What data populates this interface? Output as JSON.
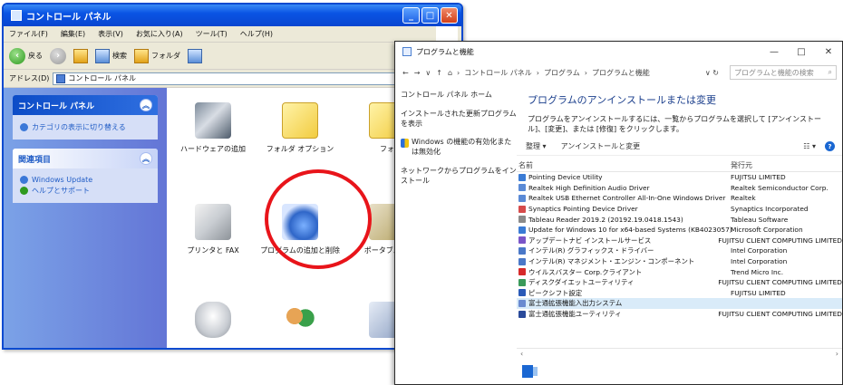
{
  "xp": {
    "title": "コントロール パネル",
    "controls": [
      "_",
      "□",
      "✕"
    ],
    "menu": [
      "ファイル(F)",
      "編集(E)",
      "表示(V)",
      "お気に入り(A)",
      "ツール(T)",
      "ヘルプ(H)"
    ],
    "toolbar": {
      "back": "戻る",
      "search": "検索",
      "folders": "フォルダ"
    },
    "address": {
      "label": "アドレス(D)",
      "value": "コントロール パネル"
    },
    "left": {
      "panel1": {
        "title": "コントロール パネル",
        "link": "カテゴリの表示に切り替える"
      },
      "panel2": {
        "title": "関連項目",
        "links": [
          "Windows Update",
          "ヘルプとサポート"
        ]
      }
    },
    "icons": [
      {
        "label": "ハードウェアの追加"
      },
      {
        "label": "フォルダ オプション"
      },
      {
        "label": "フォ"
      },
      {
        "label": "プリンタと FAX"
      },
      {
        "label": "プログラムの追加と削除"
      },
      {
        "label": "ポータブル メ"
      },
      {
        "label": ""
      },
      {
        "label": ""
      },
      {
        "label": ""
      }
    ]
  },
  "w10": {
    "title": "プログラムと機能",
    "controls": [
      "—",
      "□",
      "✕"
    ],
    "nav": {
      "breadcrumb": [
        "コントロール パネル",
        "プログラム",
        "プログラムと機能"
      ],
      "search_placeholder": "プログラムと機能の検索"
    },
    "left_links": [
      "コントロール パネル ホーム",
      "インストールされた更新プログラムを表示",
      "Windows の機能の有効化または無効化",
      "ネットワークからプログラムをインストール"
    ],
    "heading": "プログラムのアンインストールまたは変更",
    "description": "プログラムをアンインストールするには、一覧からプログラムを選択して [アンインストール]、[変更]、または [修復] をクリックします。",
    "commands": {
      "organize": "整理 ▾",
      "uninstall": "アンインストールと変更"
    },
    "columns": {
      "name": "名前",
      "publisher": "発行元"
    },
    "rows": [
      {
        "name": "Pointing Device Utility",
        "publisher": "FUJITSU LIMITED",
        "color": "#3a7bd5"
      },
      {
        "name": "Realtek High Definition Audio Driver",
        "publisher": "Realtek Semiconductor Corp.",
        "color": "#5a8ad6"
      },
      {
        "name": "Realtek USB Ethernet Controller All-In-One Windows Driver",
        "publisher": "Realtek",
        "color": "#5a8ad6"
      },
      {
        "name": "Synaptics Pointing Device Driver",
        "publisher": "Synaptics Incorporated",
        "color": "#d64b4b"
      },
      {
        "name": "Tableau Reader 2019.2 (20192.19.0418.1543)",
        "publisher": "Tableau Software",
        "color": "#8a8a8a"
      },
      {
        "name": "Update for Windows 10 for x64-based Systems (KB4023057)",
        "publisher": "Microsoft Corporation",
        "color": "#3a7bd5"
      },
      {
        "name": "アップデートナビ インストールサービス",
        "publisher": "FUJITSU CLIENT COMPUTING LIMITED",
        "color": "#7a55c8"
      },
      {
        "name": "インテル(R) グラフィックス・ドライバー",
        "publisher": "Intel Corporation",
        "color": "#4a78c8"
      },
      {
        "name": "インテル(R) マネジメント・エンジン・コンポーネント",
        "publisher": "Intel Corporation",
        "color": "#4a78c8"
      },
      {
        "name": "ウイルスバスター Corp.クライアント",
        "publisher": "Trend Micro Inc.",
        "color": "#d62a2a"
      },
      {
        "name": "ディスクダイエットユーティリティ",
        "publisher": "FUJITSU CLIENT COMPUTING LIMITED",
        "color": "#3a9a5a"
      },
      {
        "name": "ピークシフト設定",
        "publisher": "FUJITSU LIMITED",
        "color": "#2a5ab8"
      },
      {
        "name": "富士通拡張機能入出力システム",
        "publisher": "",
        "color": "#6a8ad0"
      },
      {
        "name": "富士通拡張機能ユーティリティ",
        "publisher": "FUJITSU CLIENT COMPUTING LIMITED",
        "color": "#2a4a9a"
      }
    ],
    "selected_row": 12
  }
}
